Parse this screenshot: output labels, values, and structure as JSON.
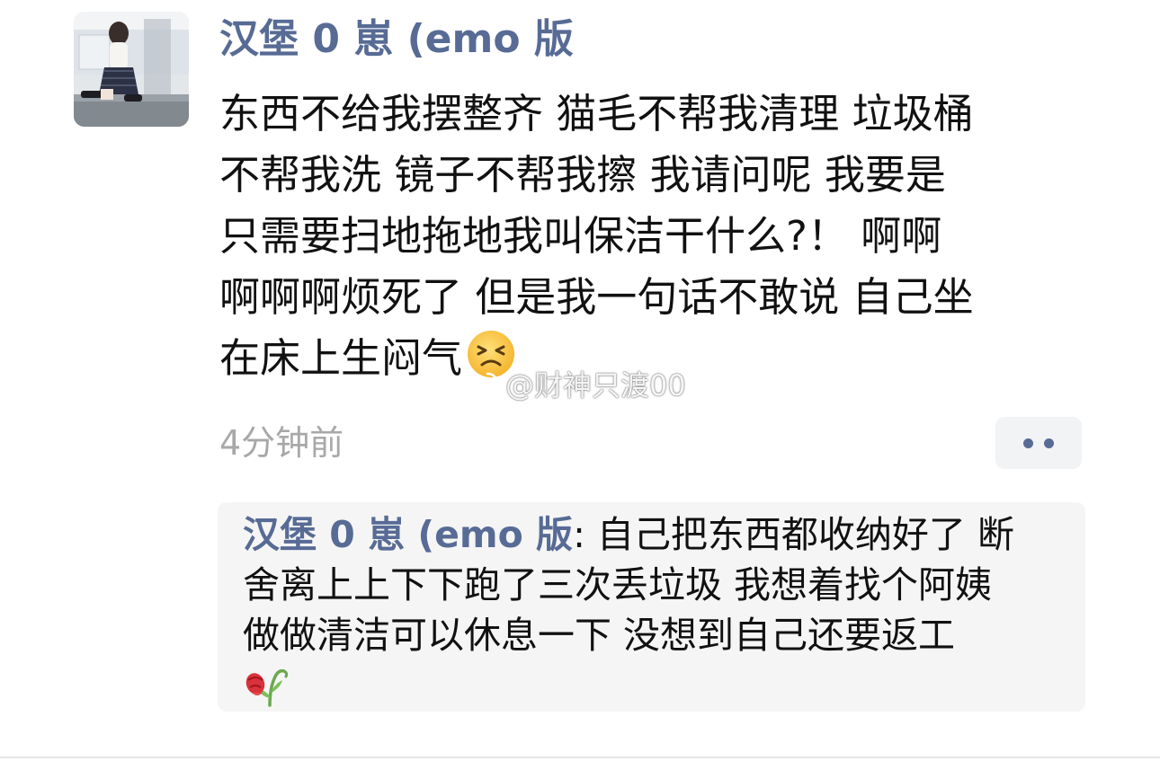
{
  "post": {
    "username": "汉堡 0 崽 (emo 版",
    "content_lines": [
      "东西不给我摆整齐 猫毛不帮我清理 垃圾桶",
      "不帮我洗 镜子不帮我擦 我请问呢 我要是",
      "只需要扫地拖地我叫保洁干什么?！ 啊啊",
      "啊啊啊烦死了 但是我一句话不敢说 自己坐",
      "在床上生闷气"
    ],
    "emoji": "persevering-face-icon",
    "timestamp": "4分钟前",
    "watermark": "@财神只渡00"
  },
  "comment": {
    "author": "汉堡 0 崽 (emo 版",
    "separator": ": ",
    "first_line": "自己把东西都收纳好了 断",
    "lines": [
      "舍离上上下下跑了三次丢垃圾 我想着找个阿姨",
      "做做清洁可以休息一下 没想到自己还要返工"
    ],
    "emoji": "wilted-flower-icon"
  },
  "colors": {
    "link": "#576b95",
    "text": "#111111",
    "timestamp": "#a8a8a8",
    "comment_bg": "#f5f5f5",
    "more_bg": "#f2f3f5"
  }
}
